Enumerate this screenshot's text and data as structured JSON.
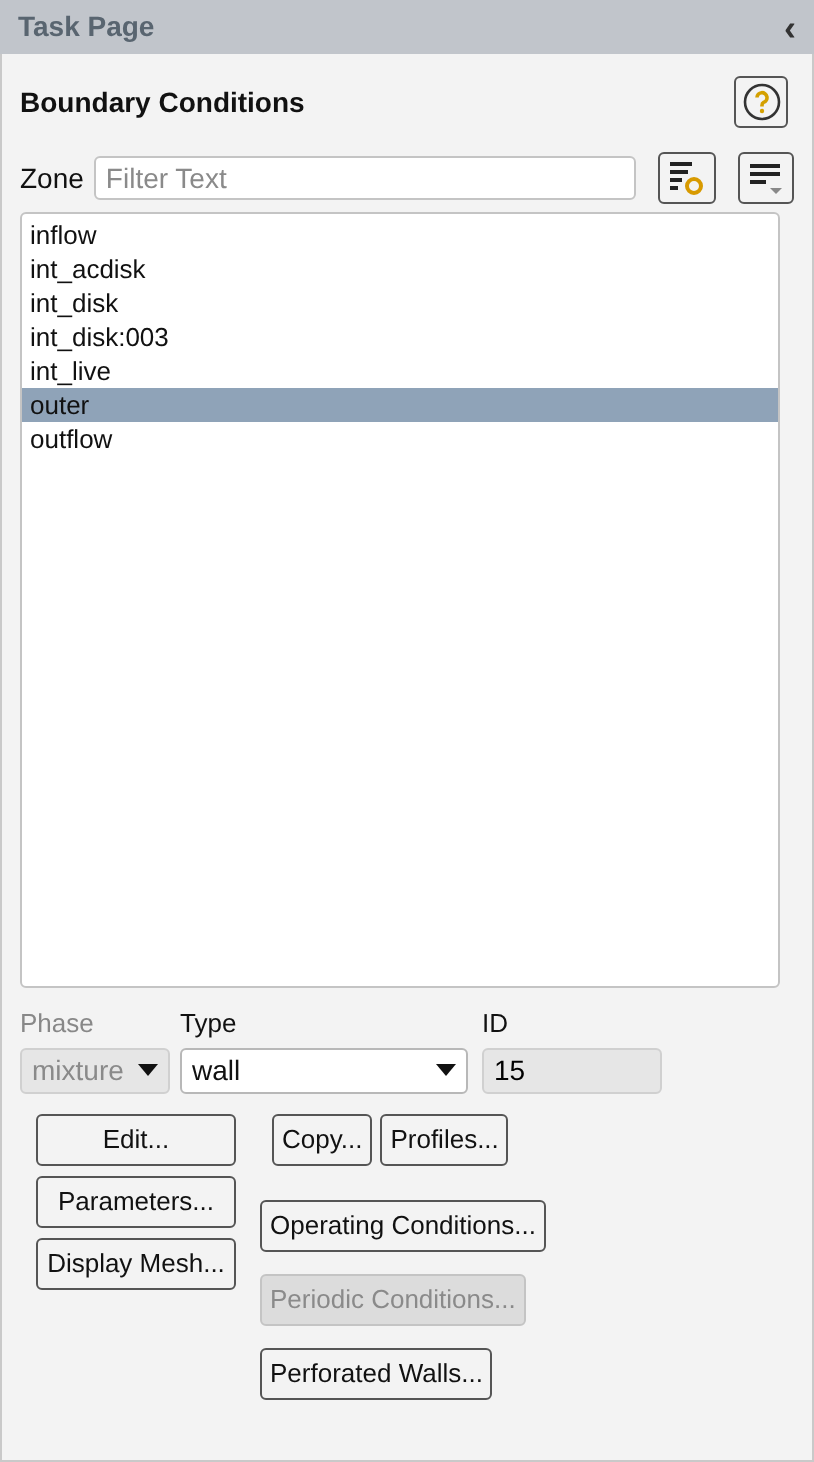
{
  "header": {
    "title": "Task Page",
    "collapse_glyph": "‹"
  },
  "panel_title": "Boundary Conditions",
  "zone": {
    "label": "Zone",
    "placeholder": "Filter Text"
  },
  "zones": [
    {
      "name": "inflow",
      "selected": false
    },
    {
      "name": "int_acdisk",
      "selected": false
    },
    {
      "name": "int_disk",
      "selected": false
    },
    {
      "name": "int_disk:003",
      "selected": false
    },
    {
      "name": "int_live",
      "selected": false
    },
    {
      "name": "outer",
      "selected": true
    },
    {
      "name": "outflow",
      "selected": false
    }
  ],
  "phase": {
    "label": "Phase",
    "value": "mixture",
    "disabled": true
  },
  "type": {
    "label": "Type",
    "value": "wall",
    "disabled": false
  },
  "id": {
    "label": "ID",
    "value": "15"
  },
  "left_buttons": [
    {
      "label": "Edit...",
      "disabled": false
    },
    {
      "label": "Parameters...",
      "disabled": false
    },
    {
      "label": "Display Mesh...",
      "disabled": false
    }
  ],
  "right_buttons": [
    [
      {
        "label": "Copy...",
        "disabled": false
      },
      {
        "label": "Profiles...",
        "disabled": false
      }
    ],
    [
      {
        "label": "Operating Conditions...",
        "disabled": false
      }
    ],
    [
      {
        "label": "Periodic Conditions...",
        "disabled": true
      }
    ],
    [
      {
        "label": "Perforated Walls...",
        "disabled": false
      }
    ]
  ]
}
